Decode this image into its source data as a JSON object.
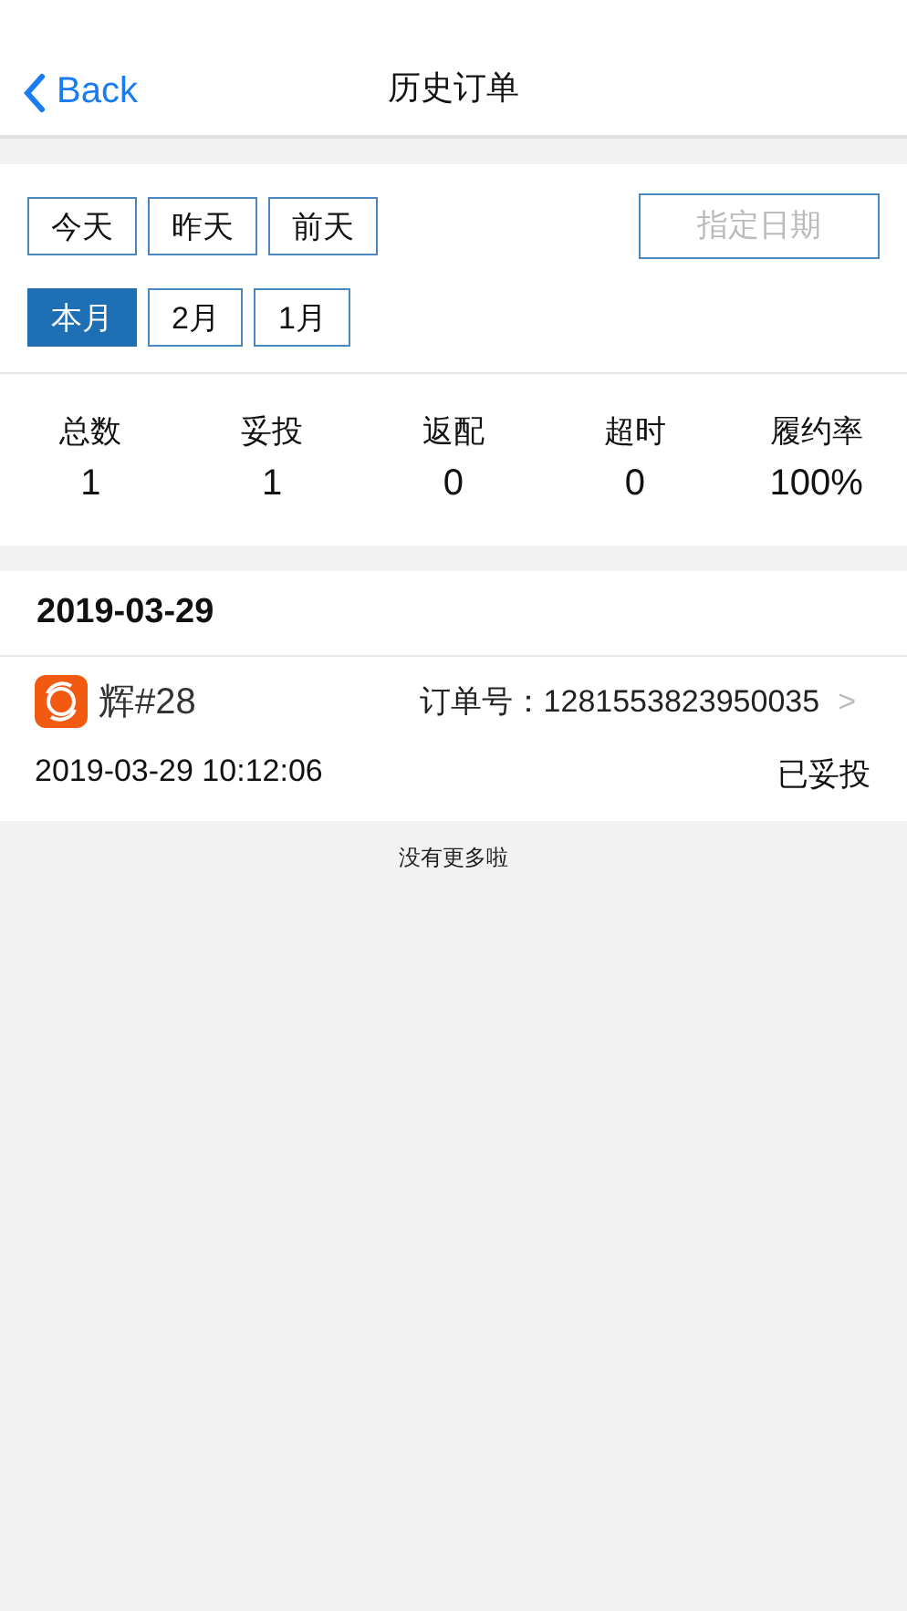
{
  "nav": {
    "back": "Back",
    "title": "历史订单"
  },
  "day_filters": [
    {
      "label": "今天",
      "selected": false
    },
    {
      "label": "昨天",
      "selected": false
    },
    {
      "label": "前天",
      "selected": false
    }
  ],
  "date_picker": {
    "placeholder": "指定日期"
  },
  "month_filters": [
    {
      "label": "本月",
      "selected": true
    },
    {
      "label": "2月",
      "selected": false
    },
    {
      "label": "1月",
      "selected": false
    }
  ],
  "stats": [
    {
      "label": "总数",
      "value": "1"
    },
    {
      "label": "妥投",
      "value": "1"
    },
    {
      "label": "返配",
      "value": "0"
    },
    {
      "label": "超时",
      "value": "0"
    },
    {
      "label": "履约率",
      "value": "100%"
    }
  ],
  "groups": [
    {
      "date": "2019-03-29",
      "orders": [
        {
          "store": "辉#28",
          "order_no": "订单号：1281553823950035",
          "chevron": ">",
          "time": "2019-03-29 10:12:06",
          "status": "已妥投"
        }
      ]
    }
  ],
  "footer": "没有更多啦"
}
